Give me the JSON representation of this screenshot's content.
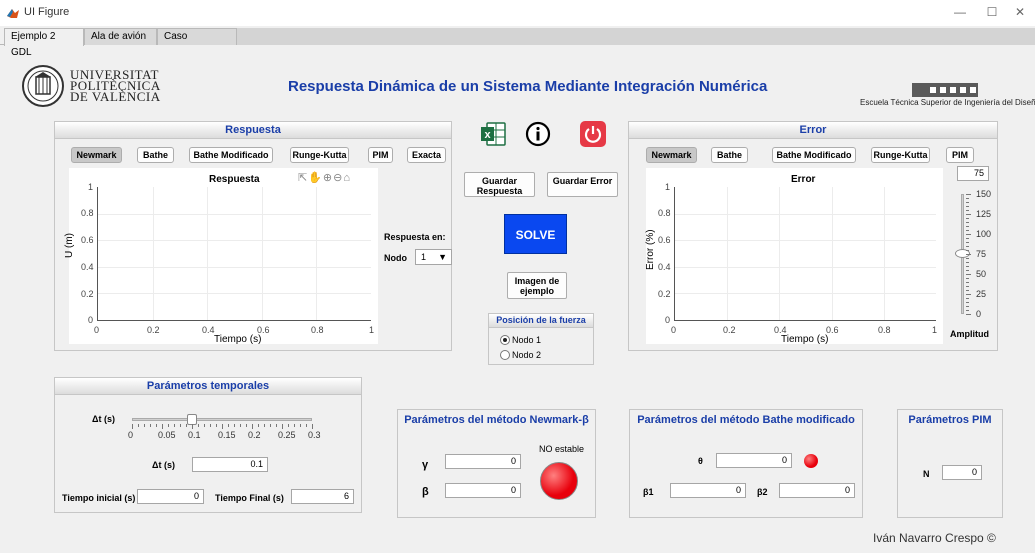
{
  "window": {
    "title": "UI Figure",
    "min": "—",
    "max": "☐",
    "close": "✕"
  },
  "tabs": [
    {
      "label": "Ejemplo 2 GDL"
    },
    {
      "label": "Ala de avión"
    },
    {
      "label": "Caso Genérico"
    }
  ],
  "logo": {
    "line1": "UNIVERSITAT",
    "line2": "POLITÈCNICA",
    "line3": "DE VALÈNCIA",
    "school": "Escuela Técnica Superior de Ingeniería del Diseño"
  },
  "main_title": "Respuesta Dinámica de un Sistema Mediante Integración Numérica",
  "respuesta_panel": {
    "title": "Respuesta",
    "methods": [
      "Newmark",
      "Bathe",
      "Bathe Modificado",
      "Runge-Kutta",
      "PIM",
      "Exacta"
    ],
    "plot_title": "Respuesta",
    "xlabel": "Tiempo (s)",
    "ylabel": "U (m)",
    "xticks": [
      "0",
      "0.2",
      "0.4",
      "0.6",
      "0.8",
      "1"
    ],
    "yticks": [
      "1",
      "0.8",
      "0.6",
      "0.4",
      "0.2",
      "0"
    ],
    "respuesta_en": "Respuesta en:",
    "nodo_label": "Nodo",
    "nodo_value": "1"
  },
  "center": {
    "guardar_respuesta": "Guardar Respuesta",
    "guardar_error": "Guardar Error",
    "solve": "SOLVE",
    "imagen": "Imagen de ejemplo",
    "posicion_title": "Posición de la fuerza",
    "nodo1": "Nodo 1",
    "nodo2": "Nodo 2"
  },
  "error_panel": {
    "title": "Error",
    "methods": [
      "Newmark",
      "Bathe",
      "Bathe Modificado",
      "Runge-Kutta",
      "PIM"
    ],
    "plot_title": "Error",
    "xlabel": "Tiempo (s)",
    "ylabel": "Error (%)",
    "xticks": [
      "0",
      "0.2",
      "0.4",
      "0.6",
      "0.8",
      "1"
    ],
    "yticks": [
      "1",
      "0.8",
      "0.6",
      "0.4",
      "0.2",
      "0"
    ],
    "amplitud_value": "75",
    "amplitud_label": "Amplitud",
    "slider_ticks": [
      "150",
      "125",
      "100",
      "75",
      "50",
      "25",
      "0"
    ],
    "slider_fraction": 0.5
  },
  "temporales": {
    "title": "Parámetros temporales",
    "dt_slider_label": "Δt (s)",
    "dt_ticks": [
      "0",
      "0.05",
      "0.1",
      "0.15",
      "0.2",
      "0.25",
      "0.3"
    ],
    "dt_fraction": 0.333,
    "dt_label": "Δt (s)",
    "dt_value": "0.1",
    "ti_label": "Tiempo inicial (s)",
    "ti_value": "0",
    "tf_label": "Tiempo Final (s)",
    "tf_value": "6"
  },
  "newmark": {
    "title": "Parámetros del método Newmark-β",
    "gamma_label": "γ",
    "gamma_value": "0",
    "beta_label": "β",
    "beta_value": "0",
    "status": "NO estable",
    "lamp_color": "#e8000c"
  },
  "bathe_mod": {
    "title": "Parámetros del método Bathe modificado",
    "theta_label": "θ",
    "theta_value": "0",
    "b1_label": "β1",
    "b1_value": "0",
    "b2_label": "β2",
    "b2_value": "0",
    "lamp_color": "#e8000c"
  },
  "pim": {
    "title": "Parámetros PIM",
    "n_label": "N",
    "n_value": "0"
  },
  "author": "Iván Navarro Crespo ©"
}
